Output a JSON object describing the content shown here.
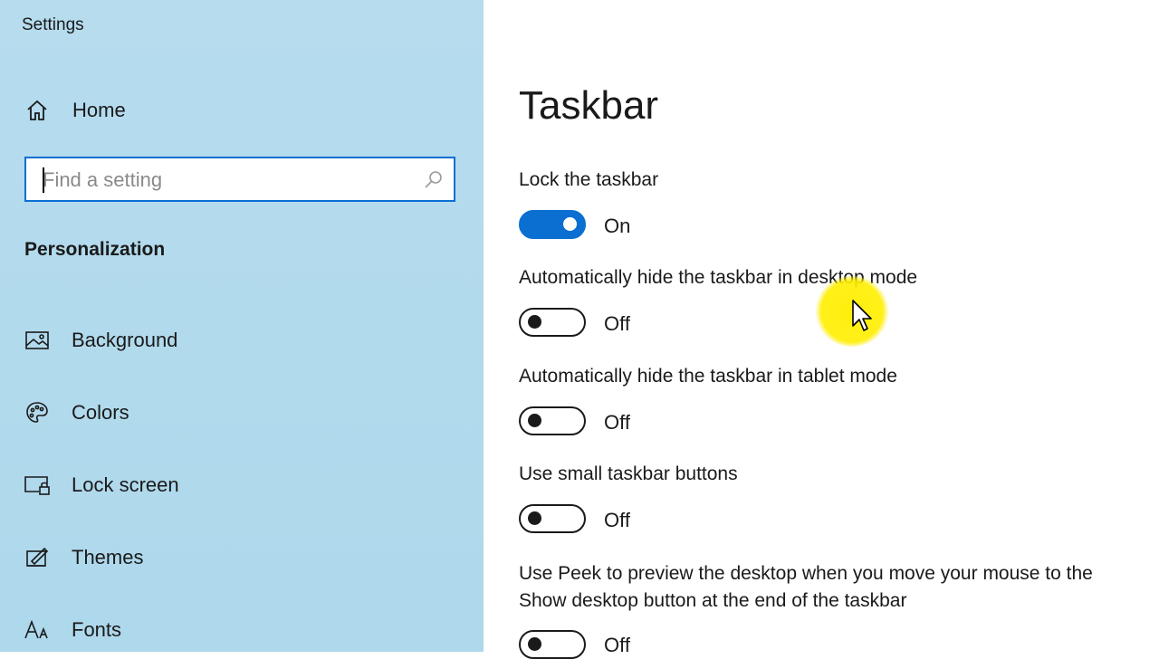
{
  "window": {
    "title": "Settings"
  },
  "sidebar": {
    "home_label": "Home",
    "search_placeholder": "Find a setting",
    "section_heading": "Personalization",
    "items": [
      {
        "label": "Background",
        "icon": "picture-icon"
      },
      {
        "label": "Colors",
        "icon": "palette-icon"
      },
      {
        "label": "Lock screen",
        "icon": "lock-screen-icon"
      },
      {
        "label": "Themes",
        "icon": "themes-icon"
      },
      {
        "label": "Fonts",
        "icon": "fonts-icon"
      }
    ]
  },
  "main": {
    "title": "Taskbar",
    "settings": [
      {
        "label": "Lock the taskbar",
        "state": "On"
      },
      {
        "label": "Automatically hide the taskbar in desktop mode",
        "state": "Off"
      },
      {
        "label": "Automatically hide the taskbar in tablet mode",
        "state": "Off"
      },
      {
        "label": "Use small taskbar buttons",
        "state": "Off"
      },
      {
        "label_line1": "Use Peek to preview the desktop when you move your mouse to the",
        "label_line2": "Show desktop button at the end of the taskbar",
        "state": "Off"
      }
    ]
  },
  "colors": {
    "accent": "#0a6fd1",
    "sidebar_bg": "#b0d9ed",
    "cursor_highlight": "#ffee00"
  }
}
